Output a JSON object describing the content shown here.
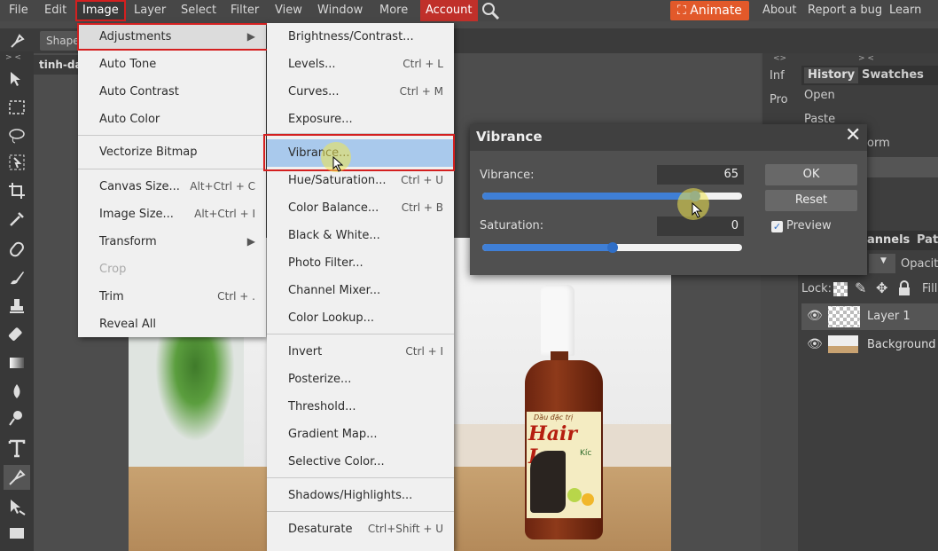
{
  "menubar": {
    "items": [
      "File",
      "Edit",
      "Image",
      "Layer",
      "Select",
      "Filter",
      "View",
      "Window",
      "More"
    ],
    "account": "Account",
    "animate": "Animate",
    "about": "About",
    "report": "Report a bug",
    "learn": "Learn"
  },
  "options": {
    "shape_label": "Shape"
  },
  "document": {
    "tab": "tinh-da"
  },
  "image_menu": {
    "items": [
      {
        "label": "Adjustments",
        "shortcut": "",
        "submenu": true
      },
      {
        "label": "Auto Tone",
        "shortcut": ""
      },
      {
        "label": "Auto Contrast",
        "shortcut": ""
      },
      {
        "label": "Auto Color",
        "shortcut": ""
      },
      {
        "label": "Vectorize Bitmap",
        "shortcut": ""
      },
      {
        "label": "Canvas Size...",
        "shortcut": "Alt+Ctrl + C"
      },
      {
        "label": "Image Size...",
        "shortcut": "Alt+Ctrl + I"
      },
      {
        "label": "Transform",
        "shortcut": "",
        "submenu": true
      },
      {
        "label": "Crop",
        "shortcut": "",
        "disabled": true
      },
      {
        "label": "Trim",
        "shortcut": "Ctrl + ."
      },
      {
        "label": "Reveal All",
        "shortcut": ""
      }
    ]
  },
  "adjust_menu": {
    "items": [
      {
        "label": "Brightness/Contrast...",
        "shortcut": ""
      },
      {
        "label": "Levels...",
        "shortcut": "Ctrl + L"
      },
      {
        "label": "Curves...",
        "shortcut": "Ctrl + M"
      },
      {
        "label": "Exposure...",
        "shortcut": ""
      },
      {
        "label": "Vibrance...",
        "shortcut": ""
      },
      {
        "label": "Hue/Saturation...",
        "shortcut": "Ctrl + U"
      },
      {
        "label": "Color Balance...",
        "shortcut": "Ctrl + B"
      },
      {
        "label": "Black & White...",
        "shortcut": ""
      },
      {
        "label": "Photo Filter...",
        "shortcut": ""
      },
      {
        "label": "Channel Mixer...",
        "shortcut": ""
      },
      {
        "label": "Color Lookup...",
        "shortcut": ""
      },
      {
        "label": "Invert",
        "shortcut": "Ctrl + I"
      },
      {
        "label": "Posterize...",
        "shortcut": ""
      },
      {
        "label": "Threshold...",
        "shortcut": ""
      },
      {
        "label": "Gradient Map...",
        "shortcut": ""
      },
      {
        "label": "Selective Color...",
        "shortcut": ""
      },
      {
        "label": "Shadows/Highlights...",
        "shortcut": ""
      },
      {
        "label": "Desaturate",
        "shortcut": "Ctrl+Shift + U"
      }
    ]
  },
  "dialog": {
    "title": "Vibrance",
    "vibrance_label": "Vibrance:",
    "vibrance_value": "65",
    "vibrance_fraction": 0.82,
    "saturation_label": "Saturation:",
    "saturation_value": "0",
    "saturation_fraction": 0.5,
    "ok": "OK",
    "reset": "Reset",
    "preview": "Preview",
    "preview_checked": true
  },
  "panels": {
    "strip_inf": "Inf",
    "strip_pro": "Pro",
    "history_tab": "History",
    "swatches_tab": "Swatches",
    "history_items": [
      "Open",
      "Paste",
      "orm"
    ],
    "channels_tab": "annels",
    "paths_tab": "Path",
    "opacity": "Opacity",
    "lock": "Lock:",
    "fill": "Fill",
    "layers": [
      "Layer 1",
      "Background"
    ]
  },
  "product": {
    "label_top": "Dầu đặc trị",
    "label_main": "Hair Lo",
    "label_small": "Kíc"
  },
  "colors": {
    "accent_blue": "#3f7fd6",
    "account_red": "#c0302a",
    "animate_orange": "#e2592a",
    "highlight_red": "#d41f1f"
  }
}
